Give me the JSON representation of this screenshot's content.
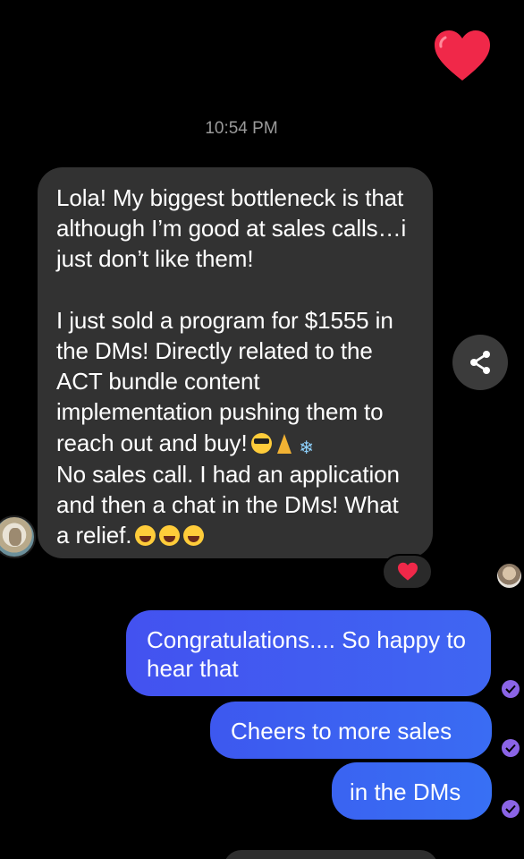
{
  "colors": {
    "background": "#000000",
    "incoming_bubble": "#323232",
    "outgoing_bubble": "#3f5cf0",
    "heart": "#f02849",
    "seen_check": "#8b64e6",
    "timestamp_text": "#9a9a9a"
  },
  "thread": {
    "timestamp": "10:54 PM",
    "top_reaction_icon": "heart-icon",
    "incoming_message": {
      "text": "Lola! My biggest bottleneck is that although I’m good at sales calls…i just don’t like them!\n\nI just sold a program for $1555 in the DMs! Directly related to the ACT bundle content implementation pushing them to reach out and buy!",
      "text_line2": "No sales call. I had an application and then a chat in the DMs! What a relief.",
      "emojis_line1": [
        "smiling-face-with-sunglasses-emoji",
        "folded-hands-emoji",
        "snowflake-emoji"
      ],
      "emojis_line2": [
        "face-with-tears-of-joy-emoji",
        "face-with-tears-of-joy-emoji",
        "face-with-tears-of-joy-emoji"
      ],
      "reaction": "heart-icon"
    },
    "outgoing_messages": [
      {
        "text": "Congratulations.... So happy to hear that"
      },
      {
        "text": "Cheers to more sales"
      },
      {
        "text": "in the DMs"
      }
    ],
    "share_icon": "share-icon",
    "seen_icon": "check-circle-icon"
  }
}
